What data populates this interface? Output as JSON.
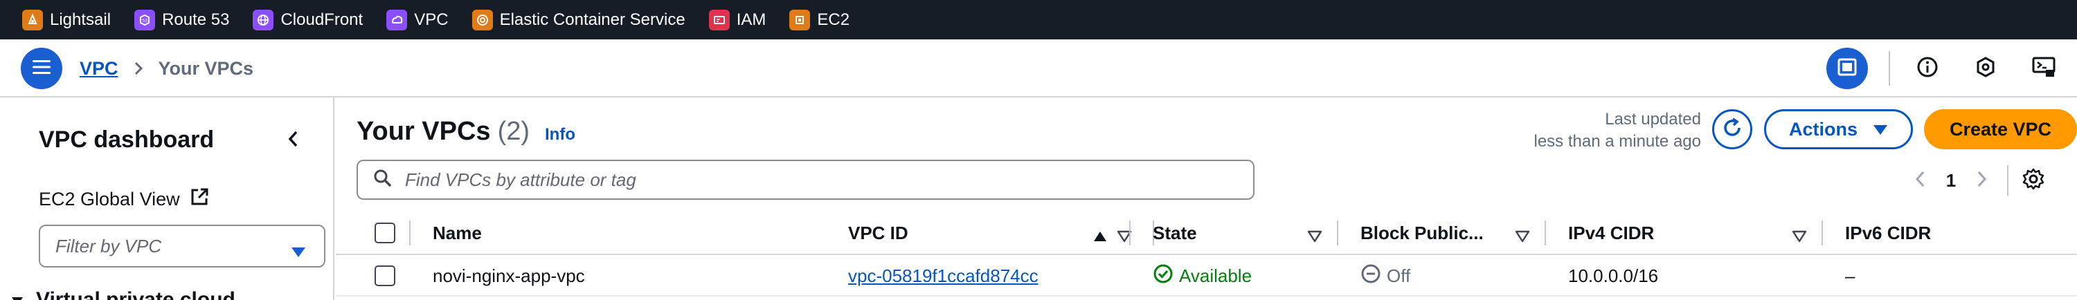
{
  "favorites_bar": {
    "items": [
      {
        "label": "Lightsail",
        "icon": "lightsail-icon",
        "color": "#e07b1a"
      },
      {
        "label": "Route 53",
        "icon": "route53-icon",
        "color": "#8c4fff"
      },
      {
        "label": "CloudFront",
        "icon": "cloudfront-icon",
        "color": "#8c4fff"
      },
      {
        "label": "VPC",
        "icon": "vpc-icon",
        "color": "#8c4fff"
      },
      {
        "label": "Elastic Container Service",
        "icon": "ecs-icon",
        "color": "#e07b1a"
      },
      {
        "label": "IAM",
        "icon": "iam-icon",
        "color": "#dd344c"
      },
      {
        "label": "EC2",
        "icon": "ec2-icon",
        "color": "#e07b1a"
      }
    ]
  },
  "header": {
    "breadcrumb": {
      "root": "VPC",
      "current": "Your VPCs"
    },
    "icons": [
      "layout-icon",
      "info-circle-icon",
      "notifications-icon",
      "cloudshell-icon"
    ]
  },
  "sidebar": {
    "title": "VPC dashboard",
    "ec2_global_view": "EC2 Global View",
    "filter_placeholder": "Filter by VPC",
    "section_partial": "Virtual private cloud"
  },
  "main": {
    "title": "Your VPCs",
    "count": "(2)",
    "info_label": "Info",
    "last_updated_line1": "Last updated",
    "last_updated_line2": "less than a minute ago",
    "actions_label": "Actions",
    "create_label": "Create VPC",
    "search_placeholder": "Find VPCs by attribute or tag",
    "page_number": "1",
    "columns": [
      "Name",
      "VPC ID",
      "State",
      "Block Public...",
      "IPv4 CIDR",
      "IPv6 CIDR"
    ],
    "rows": [
      {
        "name": "novi-nginx-app-vpc",
        "vpc_id": "vpc-05819f1ccafd874cc",
        "state": "Available",
        "block_public": "Off",
        "ipv4_cidr": "10.0.0.0/16",
        "ipv6_cidr": "–"
      }
    ]
  },
  "colors": {
    "top_bar": "#161d26",
    "link": "#0656c2",
    "primary_button": "#ff9900",
    "accent_blue": "#1a5fd1",
    "success": "#037f0c"
  }
}
